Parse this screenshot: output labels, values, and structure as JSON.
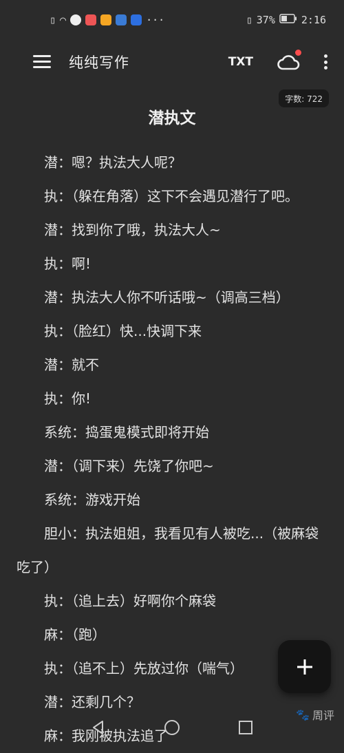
{
  "status_bar": {
    "battery": "37%",
    "time": "2:16"
  },
  "toolbar": {
    "app_title": "纯纯写作",
    "txt_label": "TXT"
  },
  "word_count": "字数: 722",
  "document": {
    "title": "潜执文",
    "paragraphs": [
      "潜：嗯？执法大人呢？",
      "执：（躲在角落）这下不会遇见潜行了吧。",
      "潜：找到你了哦，执法大人~",
      "执：啊!",
      "潜：执法大人你不听话哦~（调高三档）",
      "执：（脸红）快...快调下来",
      "潜：就不",
      "执：你!",
      "系统：捣蛋鬼模式即将开始",
      "潜：（调下来）先饶了你吧~",
      "系统：游戏开始",
      "胆小：执法姐姐，我看见有人被吃...（被麻袋吃了）",
      "执：（追上去）好啊你个麻袋",
      "麻：（跑）",
      "执：（追不上）先放过你（喘气）",
      "潜：还剩几个？",
      "麻：我刚被执法追了"
    ]
  },
  "watermark": "周评"
}
